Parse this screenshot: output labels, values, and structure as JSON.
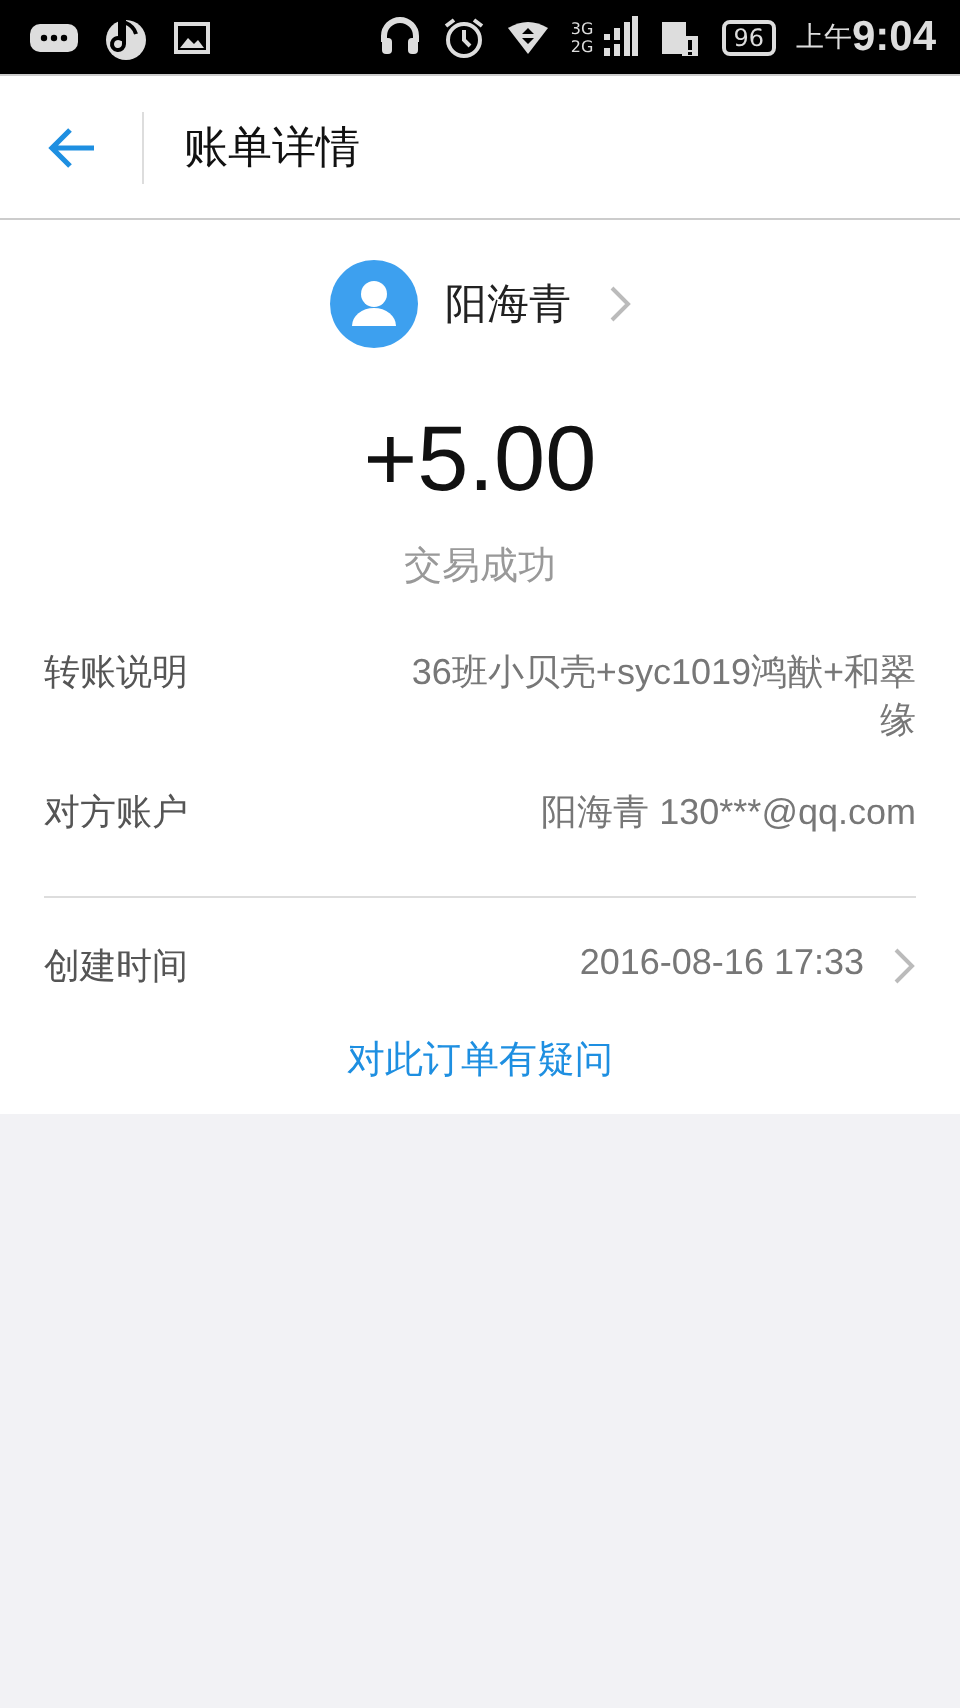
{
  "status_bar": {
    "network_top": "3G",
    "network_bottom": "2G",
    "battery": "96",
    "period": "上午",
    "time": "9:04"
  },
  "header": {
    "title": "账单详情"
  },
  "payee": {
    "name": "阳海青"
  },
  "amount": "+5.00",
  "status": "交易成功",
  "sections": [
    [
      {
        "label": "转账说明",
        "value": "36班小贝壳+syc1019鸿猷+和翠缘",
        "chevron": false
      },
      {
        "label": "对方账户",
        "value": "阳海青 130***@qq.com",
        "chevron": false
      }
    ],
    [
      {
        "label": "创建时间",
        "value": "2016-08-16 17:33",
        "chevron": true
      }
    ]
  ],
  "link": "对此订单有疑问"
}
